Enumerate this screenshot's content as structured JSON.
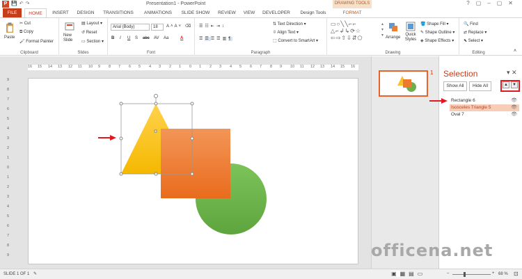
{
  "window": {
    "title": "Presentation1 - PowerPoint",
    "app_icon": "P",
    "context_tab_header": "DRAWING TOOLS",
    "controls": [
      "?",
      "▢",
      "–",
      "▢",
      "✕"
    ]
  },
  "tabs": [
    "FILE",
    "HOME",
    "INSERT",
    "DESIGN",
    "TRANSITIONS",
    "ANIMATIONS",
    "SLIDE SHOW",
    "REVIEW",
    "VIEW",
    "DEVELOPER",
    "Design Tools",
    "FORMAT"
  ],
  "ribbon": {
    "clipboard": {
      "label": "Clipboard",
      "paste": "Paste",
      "cut": "Cut",
      "copy": "Copy",
      "format_painter": "Format Painter"
    },
    "slides": {
      "label": "Slides",
      "new_slide": "New Slide",
      "layout": "Layout",
      "reset": "Reset",
      "section": "Section"
    },
    "font": {
      "label": "Font",
      "font_name": "Arial (Body)",
      "font_size": "18",
      "bold": "B",
      "italic": "I",
      "underline": "U",
      "strike": "S",
      "abc": "abc",
      "spacing": "AV",
      "case": "Aa",
      "color": "A"
    },
    "paragraph": {
      "label": "Paragraph",
      "text_direction": "Text Direction",
      "align_text": "Align Text",
      "smartart": "Convert to SmartArt"
    },
    "drawing": {
      "label": "Drawing",
      "arrange": "Arrange",
      "quick_styles": "Quick Styles",
      "shape_fill": "Shape Fill",
      "shape_outline": "Shape Outline",
      "shape_effects": "Shape Effects"
    },
    "editing": {
      "label": "Editing",
      "find": "Find",
      "replace": "Replace",
      "select": "Select"
    }
  },
  "ruler": {
    "horizontal": [
      "16",
      "15",
      "14",
      "13",
      "12",
      "11",
      "10",
      "9",
      "8",
      "7",
      "6",
      "5",
      "4",
      "3",
      "2",
      "1",
      "0",
      "1",
      "2",
      "3",
      "4",
      "5",
      "6",
      "7",
      "8",
      "9",
      "10",
      "11",
      "12",
      "13",
      "14",
      "15",
      "16"
    ],
    "vertical": [
      "9",
      "8",
      "7",
      "6",
      "5",
      "4",
      "3",
      "2",
      "1",
      "0",
      "1",
      "2",
      "3",
      "4",
      "5",
      "6",
      "7",
      "8",
      "9"
    ]
  },
  "thumbnail": {
    "number": "1"
  },
  "selection_pane": {
    "title": "Selection",
    "show_all": "Show All",
    "hide_all": "Hide All",
    "bring_forward": "▲",
    "send_backward": "▼",
    "items": [
      {
        "name": "Rectangle 6",
        "selected": false
      },
      {
        "name": "Isosceles Triangle 5",
        "selected": true
      },
      {
        "name": "Oval 7",
        "selected": false
      }
    ]
  },
  "status": {
    "slide": "SLIDE 1 OF 1",
    "zoom": "68 %"
  },
  "watermark": "officena.net",
  "colors": {
    "accent": "#c43e1c",
    "triangle": "#fbc02d",
    "rectangle": "#ee7a2f",
    "oval": "#6ab04c",
    "marker": "#e3181e"
  }
}
